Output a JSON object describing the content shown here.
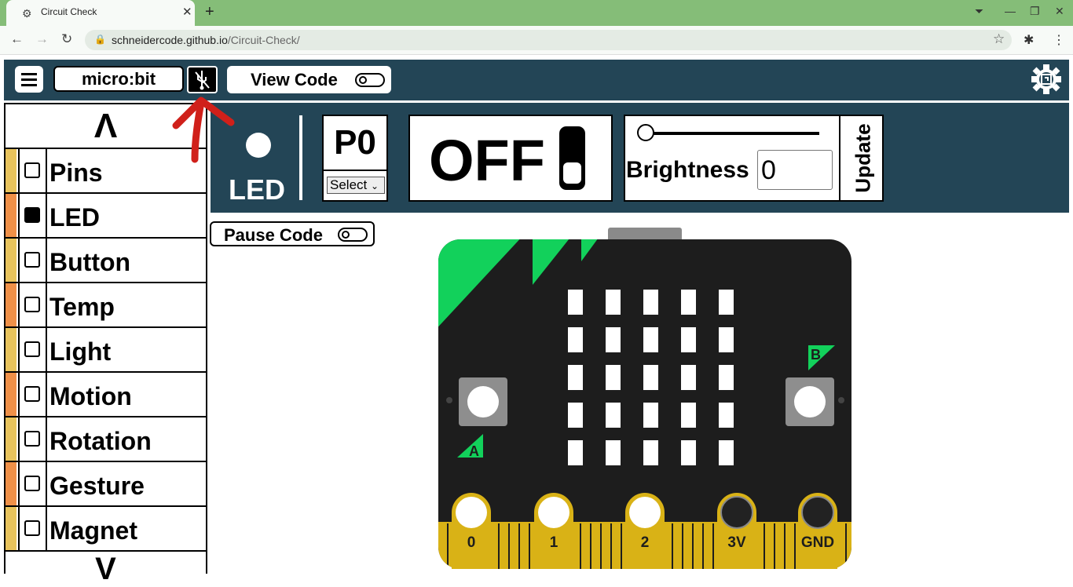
{
  "browser": {
    "tab_title": "Circuit Check",
    "url_host": "schneidercode.github.io",
    "url_path": "/Circuit-Check/"
  },
  "header": {
    "device_label": "micro:bit",
    "view_code_label": "View Code",
    "usb_icon": "usb-disconnected-icon",
    "settings_icon": "circuit-gear-icon"
  },
  "sidebar": {
    "up": "Λ",
    "down": "V",
    "items": [
      {
        "label": "Pins",
        "checked": false,
        "color": "#e8c35c"
      },
      {
        "label": "LED",
        "checked": true,
        "color": "#ef9048"
      },
      {
        "label": "Button",
        "checked": false,
        "color": "#e8c35c"
      },
      {
        "label": "Temp",
        "checked": false,
        "color": "#ef9048"
      },
      {
        "label": "Light",
        "checked": false,
        "color": "#e8c35c"
      },
      {
        "label": "Motion",
        "checked": false,
        "color": "#ef9048"
      },
      {
        "label": "Rotation",
        "checked": false,
        "color": "#e8c35c"
      },
      {
        "label": "Gesture",
        "checked": false,
        "color": "#ef9048"
      },
      {
        "label": "Magnet",
        "checked": false,
        "color": "#e8c35c"
      }
    ]
  },
  "led_panel": {
    "led_label": "LED",
    "pin_name": "P0",
    "pin_select": "Select",
    "state_text": "OFF",
    "brightness_label": "Brightness",
    "brightness_value": "0",
    "update_label": "Update"
  },
  "pause_label": "Pause Code",
  "board": {
    "button_a": "A",
    "button_b": "B",
    "pins": [
      "0",
      "1",
      "2",
      "3V",
      "GND"
    ]
  },
  "colors": {
    "header_bg": "#234556",
    "accent_green": "#12d15b",
    "pin_gold": "#d9b216"
  }
}
